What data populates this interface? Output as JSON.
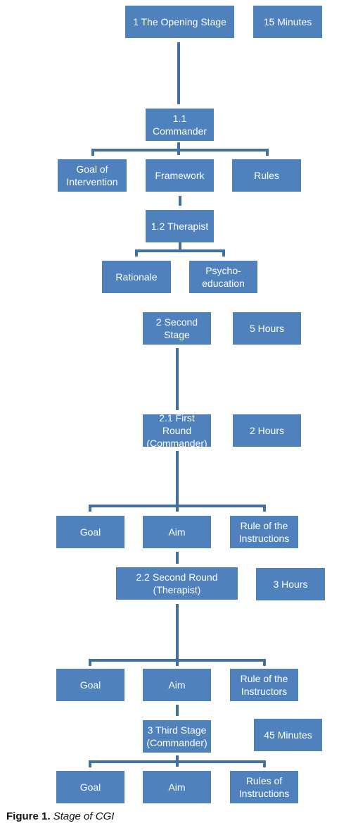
{
  "diagram": {
    "title": "Stage of CGI",
    "colors": {
      "box_fill": "#4f81bd",
      "connector": "#41719c",
      "box_text": "#ffffff"
    },
    "nodes": {
      "stage1": "1 The Opening Stage",
      "stage1_time": "15 Minutes",
      "s1_1": "1.1\nCommander",
      "s1_1_goal": "Goal of\nIntervention",
      "s1_1_framework": "Framework",
      "s1_1_rules": "Rules",
      "s1_2": "1.2 Therapist",
      "s1_2_rationale": "Rationale",
      "s1_2_psycho": "Psycho-\neducation",
      "stage2": "2 Second\nStage",
      "stage2_time": "5 Hours",
      "s2_1": "2.1 First Round\n(Commander)",
      "s2_1_time": "2 Hours",
      "s2_1_goal": "Goal",
      "s2_1_aim": "Aim",
      "s2_1_rule": "Rule of the\nInstructions",
      "s2_2": "2.2 Second Round\n(Therapist)",
      "s2_2_time": "3 Hours",
      "s2_2_goal": "Goal",
      "s2_2_aim": "Aim",
      "s2_2_rule": "Rule of the\nInstructors",
      "stage3": "3 Third Stage\n(Commander)",
      "stage3_time": "45 Minutes",
      "s3_goal": "Goal",
      "s3_aim": "Aim",
      "s3_rules": "Rules of\nInstructions"
    }
  },
  "caption": {
    "label": "Figure 1.",
    "text": "Stage of CGI"
  }
}
